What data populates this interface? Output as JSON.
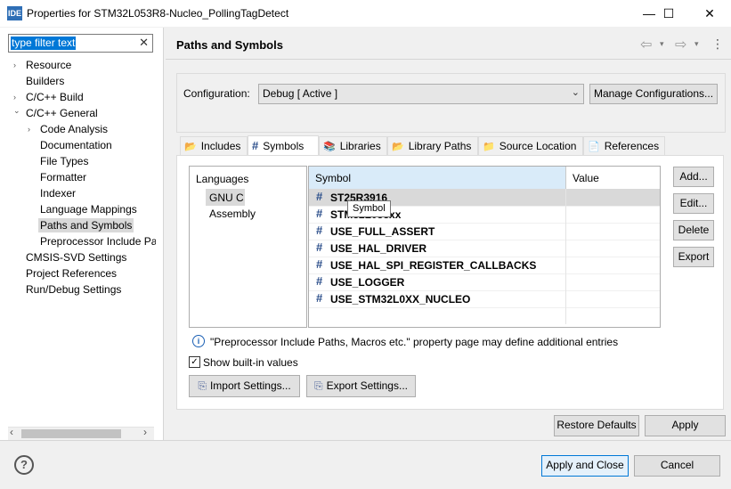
{
  "window": {
    "app_icon": "IDE",
    "title": "Properties for STM32L053R8-Nucleo_PollingTagDetect",
    "minimize": "—",
    "maximize": "☐",
    "close": "✕"
  },
  "filter": {
    "value": "type filter text",
    "clear": "✕"
  },
  "tree": [
    {
      "label": "Resource",
      "arrow": "›"
    },
    {
      "label": "Builders",
      "arrow": ""
    },
    {
      "label": "C/C++ Build",
      "arrow": "›"
    },
    {
      "label": "C/C++ General",
      "arrow": "⌄"
    },
    {
      "label": "Code Analysis",
      "arrow": "›"
    },
    {
      "label": "Documentation",
      "arrow": ""
    },
    {
      "label": "File Types",
      "arrow": ""
    },
    {
      "label": "Formatter",
      "arrow": ""
    },
    {
      "label": "Indexer",
      "arrow": ""
    },
    {
      "label": "Language Mappings",
      "arrow": ""
    },
    {
      "label": "Paths and Symbols",
      "arrow": ""
    },
    {
      "label": "Preprocessor Include Pat",
      "arrow": ""
    },
    {
      "label": "CMSIS-SVD Settings",
      "arrow": ""
    },
    {
      "label": "Project References",
      "arrow": ""
    },
    {
      "label": "Run/Debug Settings",
      "arrow": ""
    }
  ],
  "scroll": {
    "left": "‹",
    "right": "›"
  },
  "page": {
    "title": "Paths and Symbols",
    "nav_back": "⇦",
    "nav_forward": "⇨",
    "nav_menu": "▾",
    "more": "⋮"
  },
  "configuration": {
    "label": "Configuration:",
    "value": "Debug  [ Active ]",
    "manage_button": "Manage Configurations..."
  },
  "tabs": [
    {
      "label": "Includes",
      "icon": "📂"
    },
    {
      "label": "Symbols",
      "icon": "#"
    },
    {
      "label": "Libraries",
      "icon": "📚"
    },
    {
      "label": "Library Paths",
      "icon": "📂"
    },
    {
      "label": "Source Location",
      "icon": "📁"
    },
    {
      "label": "References",
      "icon": "📄"
    }
  ],
  "languages": {
    "header": "Languages",
    "items": [
      "GNU C",
      "Assembly"
    ]
  },
  "symbols": {
    "columns": [
      "Symbol",
      "Value"
    ],
    "rows": [
      {
        "name": "ST25R3916",
        "value": ""
      },
      {
        "name": "STM32L053xx",
        "value": ""
      },
      {
        "name": "USE_FULL_ASSERT",
        "value": ""
      },
      {
        "name": "USE_HAL_DRIVER",
        "value": ""
      },
      {
        "name": "USE_HAL_SPI_REGISTER_CALLBACKS",
        "value": ""
      },
      {
        "name": "USE_LOGGER",
        "value": ""
      },
      {
        "name": "USE_STM32L0XX_NUCLEO",
        "value": ""
      }
    ],
    "tooltip": "Symbol"
  },
  "side_buttons": [
    "Add...",
    "Edit...",
    "Delete",
    "Export"
  ],
  "info": {
    "icon": "i",
    "text": "\"Preprocessor Include Paths, Macros etc.\" property page may define additional entries"
  },
  "show_builtin": {
    "label": "Show built-in values",
    "checked": "✓"
  },
  "settings_buttons": {
    "import": "Import Settings...",
    "export": "Export Settings..."
  },
  "footer": {
    "restore": "Restore Defaults",
    "apply": "Apply",
    "apply_close": "Apply and Close",
    "cancel": "Cancel",
    "help": "?"
  }
}
